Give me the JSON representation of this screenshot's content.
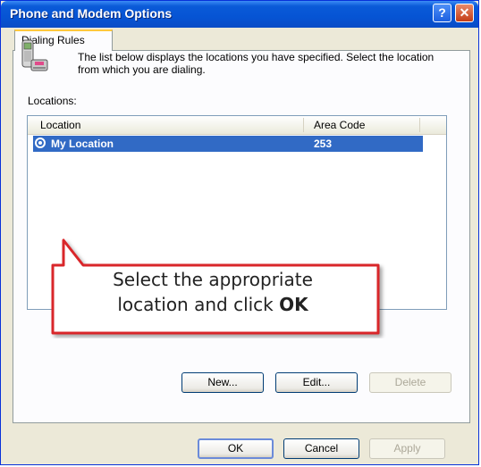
{
  "window": {
    "title": "Phone and Modem Options"
  },
  "titlebar": {
    "help_glyph": "?",
    "close_glyph": "✕"
  },
  "tabs": [
    {
      "label": "Dialing Rules",
      "active": true
    }
  ],
  "description": "The list below displays the locations you have specified. Select the location from which you are dialing.",
  "locations_label": "Locations:",
  "list": {
    "columns": [
      "Location",
      "Area Code"
    ],
    "rows": [
      {
        "location": "My Location",
        "area_code": "253",
        "selected": true
      }
    ]
  },
  "callout": {
    "text_line1": "Select the appropriate",
    "text_line2_prefix": "location and click ",
    "text_line2_bold": "OK",
    "border_color": "#d9262c"
  },
  "list_buttons": {
    "new": "New...",
    "edit": "Edit...",
    "delete": "Delete"
  },
  "dialog_buttons": {
    "ok": "OK",
    "cancel": "Cancel",
    "apply": "Apply"
  },
  "colors": {
    "titlebar": "#0a5ad8",
    "selection": "#316ac5",
    "dialog_bg": "#ece9d8"
  },
  "icons": {
    "phone": "phone-icon",
    "help": "help-icon",
    "close": "close-icon",
    "radio": "radio-selected-icon"
  }
}
